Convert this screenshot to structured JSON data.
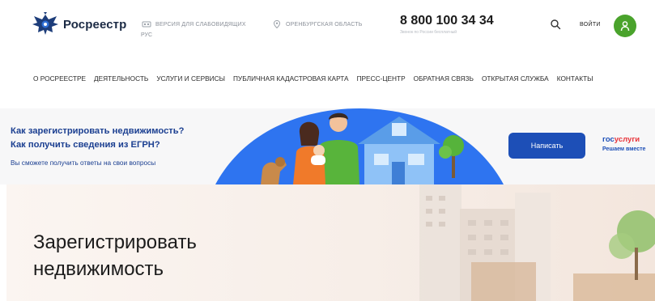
{
  "header": {
    "logo_text": "Росреестр",
    "vision_label": "ВЕРСИЯ ДЛЯ СЛАБОВИДЯЩИХ",
    "language": "РУС",
    "region_label": "ОРЕНБУРГСКАЯ ОБЛАСТЬ",
    "phone": "8 800 100 34 34",
    "phone_note": "Звонок по России бесплатный",
    "login_label": "ВОЙТИ"
  },
  "nav": {
    "items": [
      "О РОСРЕЕСТРЕ",
      "ДЕЯТЕЛЬНОСТЬ",
      "УСЛУГИ И СЕРВИСЫ",
      "ПУБЛИЧНАЯ КАДАСТРОВАЯ КАРТА",
      "ПРЕСС-ЦЕНТР",
      "ОБРАТНАЯ СВЯЗЬ",
      "ОТКРЫТАЯ СЛУЖБА",
      "КОНТАКТЫ"
    ]
  },
  "banner": {
    "question_1": "Как зарегистрировать недвижимость?",
    "question_2": "Как получить сведения из ЕГРН?",
    "subtitle": "Вы сможете получить ответы на свои вопросы",
    "button_label": "Написать",
    "gosuslugi_part1": "гос",
    "gosuslugi_part2": "услуги",
    "gosuslugi_tagline": "Решаем вместе"
  },
  "hero": {
    "title_line_1": "Зарегистрировать",
    "title_line_2": "недвижимость"
  },
  "colors": {
    "brand_blue": "#1d4fb7",
    "accent_green": "#4aa32c",
    "gos_red": "#e8333a",
    "banner_text_blue": "#1b3f91"
  }
}
